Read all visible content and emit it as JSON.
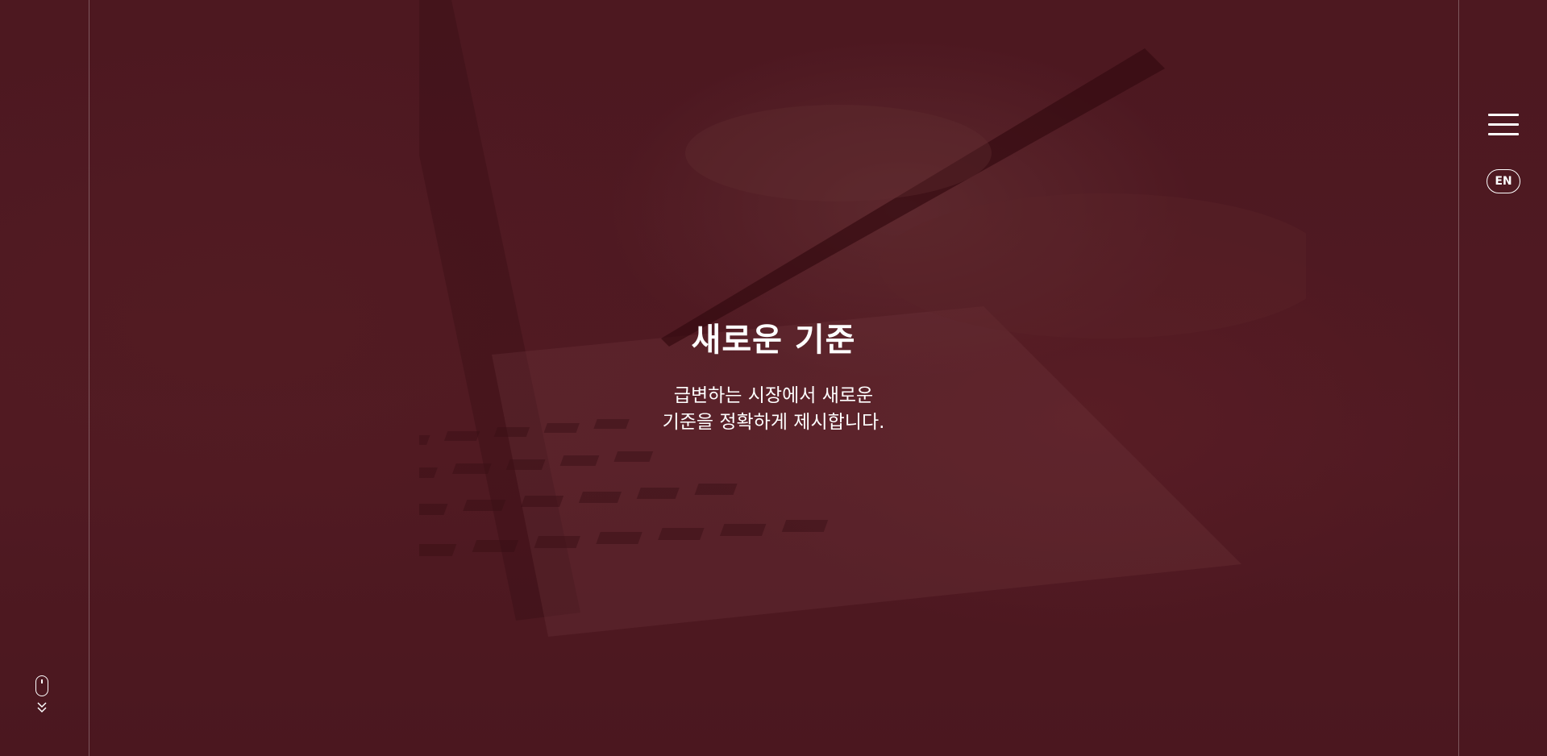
{
  "hero": {
    "title": "새로운 기준",
    "subtitle_line1": "급변하는 시장에서 새로운",
    "subtitle_line2": "기준을 정확하게 제시합니다."
  },
  "header": {
    "menu_icon": "hamburger-menu-icon",
    "language_label": "EN"
  },
  "scroll_indicator": {
    "icon": "mouse-scroll-icon",
    "arrow_icon": "double-chevron-down-icon"
  },
  "colors": {
    "overlay": "#4c141c",
    "text": "#ffffff"
  }
}
